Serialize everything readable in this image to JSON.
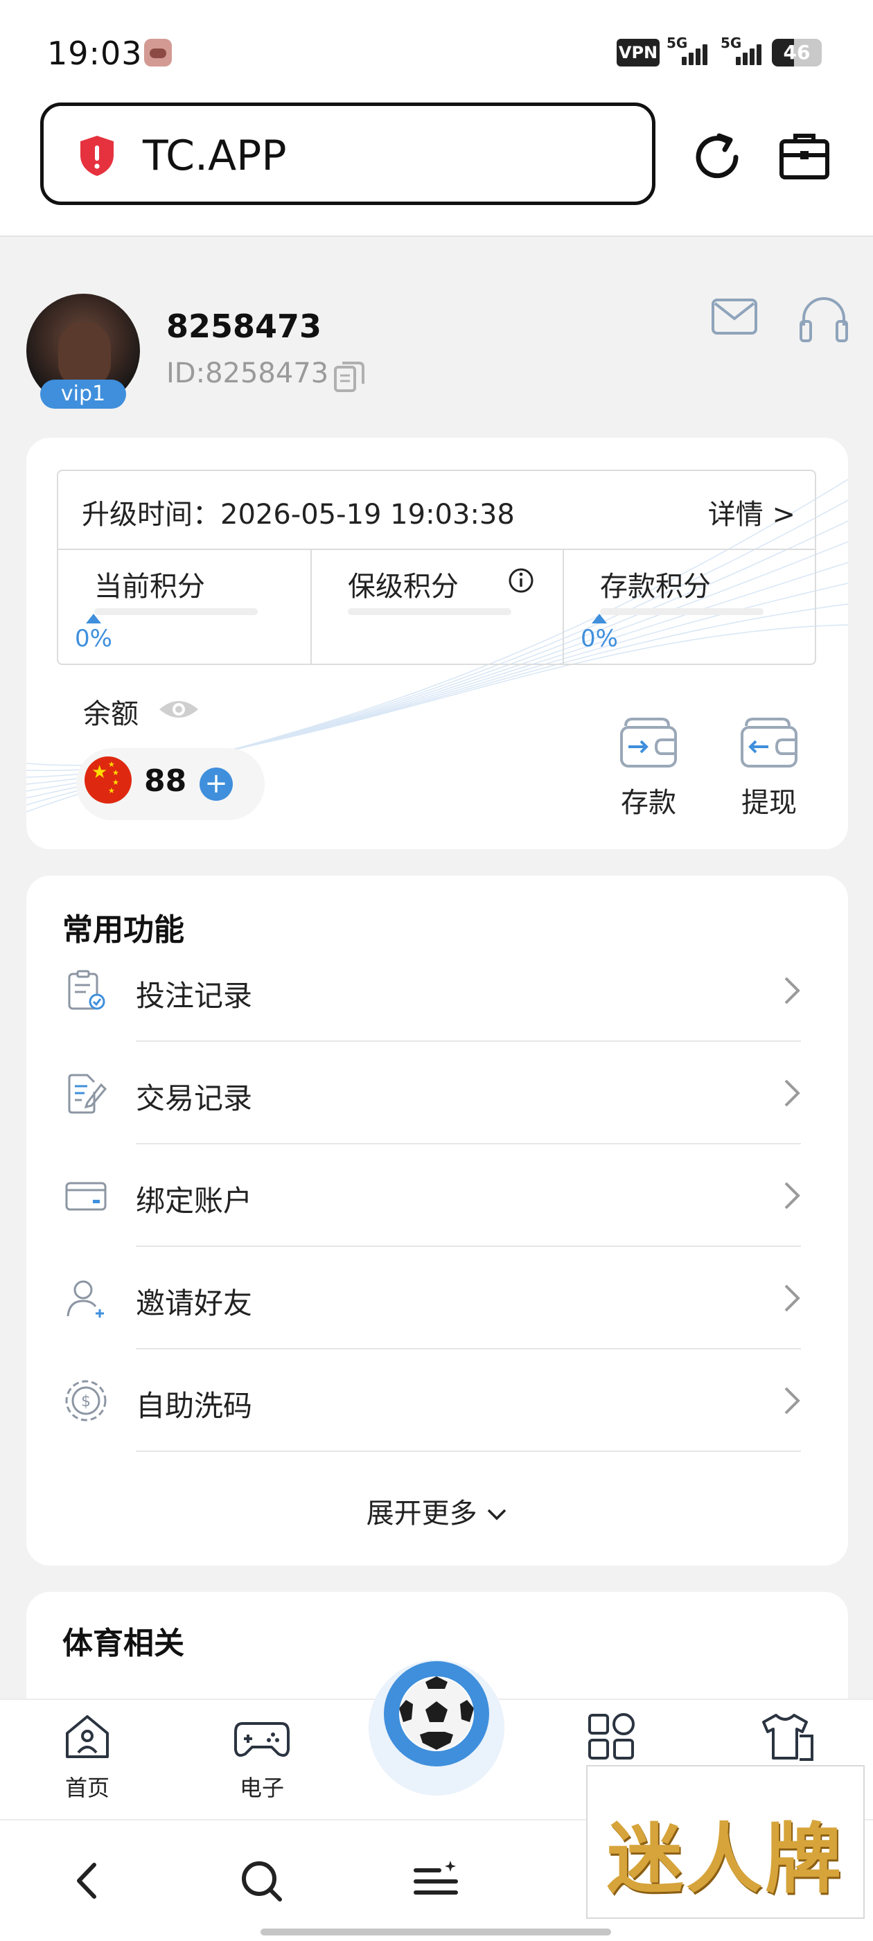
{
  "status_bar": {
    "time": "19:03",
    "vpn": "VPN",
    "network1": "5G",
    "network2": "5G",
    "battery": "46"
  },
  "url_bar": {
    "url": "TC.APP"
  },
  "profile": {
    "username": "8258473",
    "id_text": "ID:8258473",
    "vip": "vip1"
  },
  "level_card": {
    "upgrade_label": "升级时间：",
    "upgrade_time": "2026-05-19 19:03:38",
    "details": "详情 >",
    "columns": [
      {
        "label": "当前积分",
        "percent": "0%"
      },
      {
        "label": "保级积分",
        "percent": ""
      },
      {
        "label": "存款积分",
        "percent": "0%"
      }
    ],
    "balance_label": "余额",
    "balance": "88",
    "deposit": "存款",
    "withdraw": "提现"
  },
  "common_functions": {
    "title": "常用功能",
    "items": [
      {
        "label": "投注记录",
        "icon": "bet-record-icon"
      },
      {
        "label": "交易记录",
        "icon": "transaction-record-icon"
      },
      {
        "label": "绑定账户",
        "icon": "card-icon"
      },
      {
        "label": "邀请好友",
        "icon": "invite-user-icon"
      },
      {
        "label": "自助洗码",
        "icon": "rebate-chip-icon"
      }
    ],
    "expand": "展开更多"
  },
  "sports": {
    "title": "体育相关"
  },
  "bottom_nav": {
    "home": "首页",
    "electronic": "电子"
  },
  "watermark": "迷人牌",
  "colors": {
    "accent": "#3f8fdc",
    "background": "#f2f2f2"
  }
}
